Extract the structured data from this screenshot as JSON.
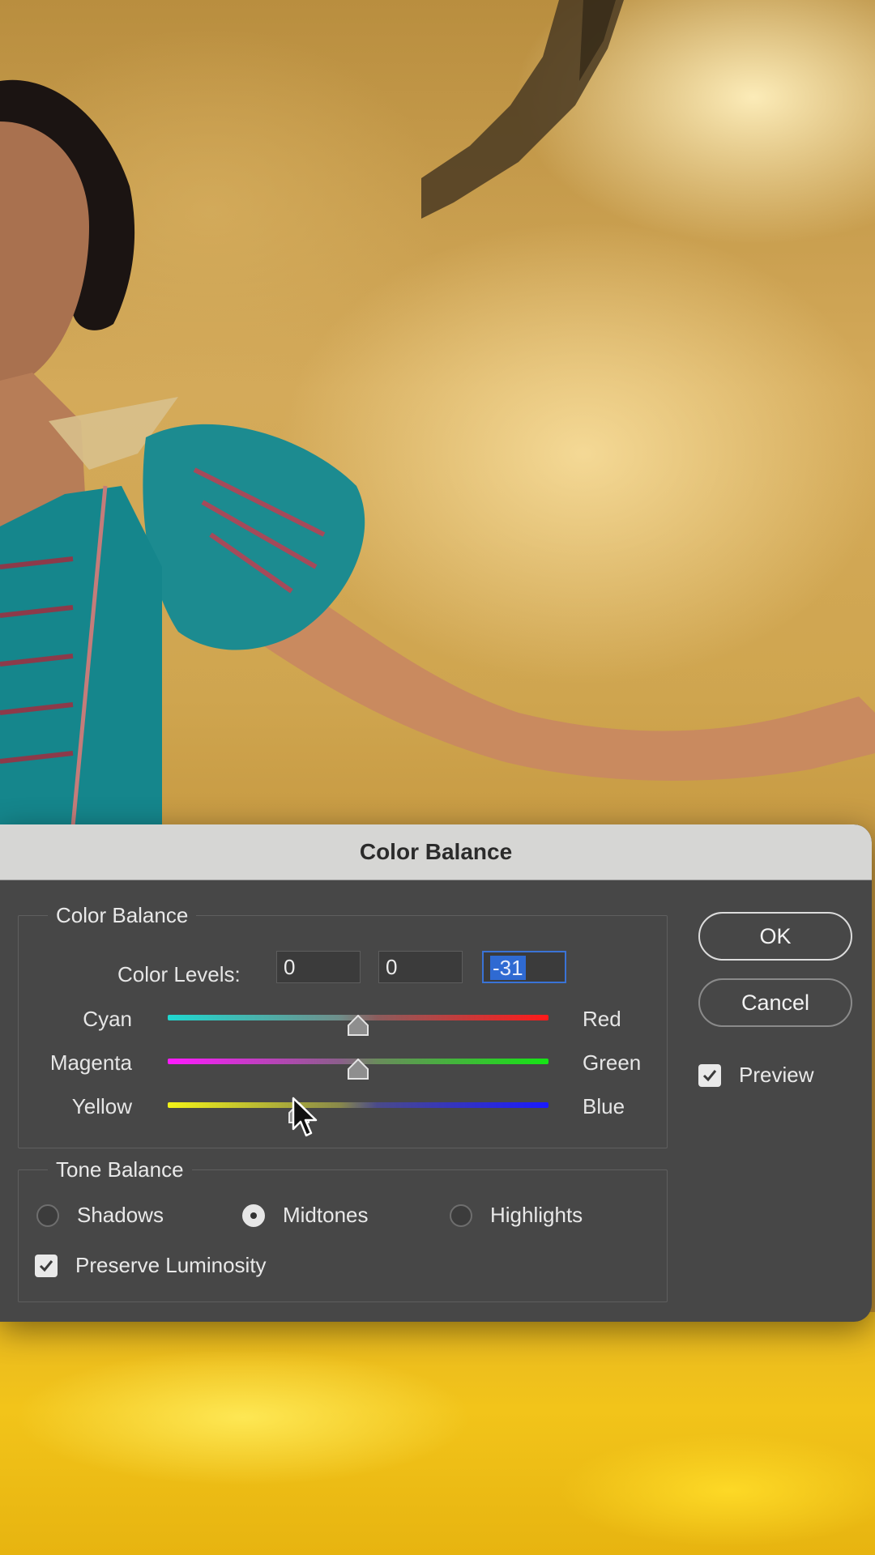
{
  "dialog": {
    "title": "Color Balance",
    "color_balance_legend": "Color Balance",
    "color_levels_label": "Color Levels:",
    "levels": [
      "0",
      "0",
      "-31"
    ],
    "sliders": [
      {
        "left": "Cyan",
        "right": "Red",
        "value": 0
      },
      {
        "left": "Magenta",
        "right": "Green",
        "value": 0
      },
      {
        "left": "Yellow",
        "right": "Blue",
        "value": -31
      }
    ],
    "slider_range": [
      -100,
      100
    ],
    "tone_balance_legend": "Tone Balance",
    "tones": [
      {
        "label": "Shadows",
        "selected": false
      },
      {
        "label": "Midtones",
        "selected": true
      },
      {
        "label": "Highlights",
        "selected": false
      }
    ],
    "preserve_luminosity_label": "Preserve Luminosity",
    "preserve_luminosity_checked": true,
    "ok_label": "OK",
    "cancel_label": "Cancel",
    "preview_label": "Preview",
    "preview_checked": true
  },
  "colors": {
    "dialog_bg": "#474747",
    "titlebar_bg": "#d6d6d4",
    "selection": "#2f6ad2"
  },
  "icons": [
    "checkmark-icon",
    "slider-thumb-icon",
    "mouse-pointer-icon"
  ]
}
